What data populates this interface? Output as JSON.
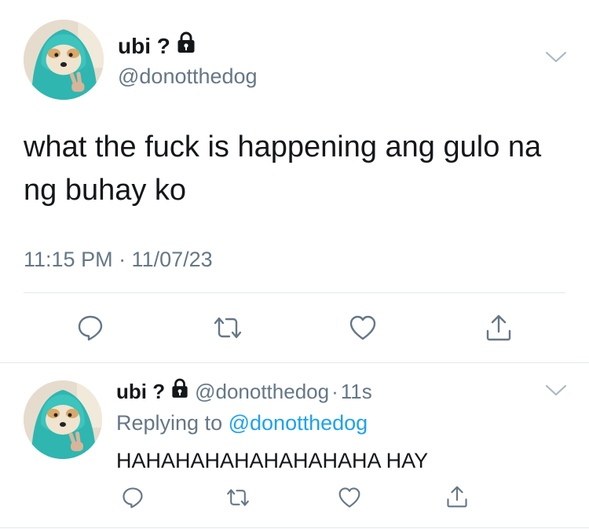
{
  "main_tweet": {
    "display_name": "ubi ?",
    "handle": "@donotthedog",
    "text": "what the fuck is happening ang gulo na ng buhay ko",
    "timestamp": "11:15 PM · 11/07/23",
    "icons": {
      "lock": "lock-icon",
      "more": "chevron-down-icon",
      "reply": "reply-icon",
      "retweet": "retweet-icon",
      "like": "heart-icon",
      "share": "share-icon"
    }
  },
  "reply_tweet": {
    "display_name": "ubi ?",
    "handle": "@donotthedog",
    "separator": "·",
    "time": "11s",
    "replying_prefix": "Replying to",
    "replying_to": "@donotthedog",
    "text": "HAHAHAHAHAHAHAHAHA HAY"
  },
  "colors": {
    "text": "#14171a",
    "secondary": "#657786",
    "link": "#1da1f2",
    "divider": "#e1e8ed",
    "icon": "#657786"
  }
}
